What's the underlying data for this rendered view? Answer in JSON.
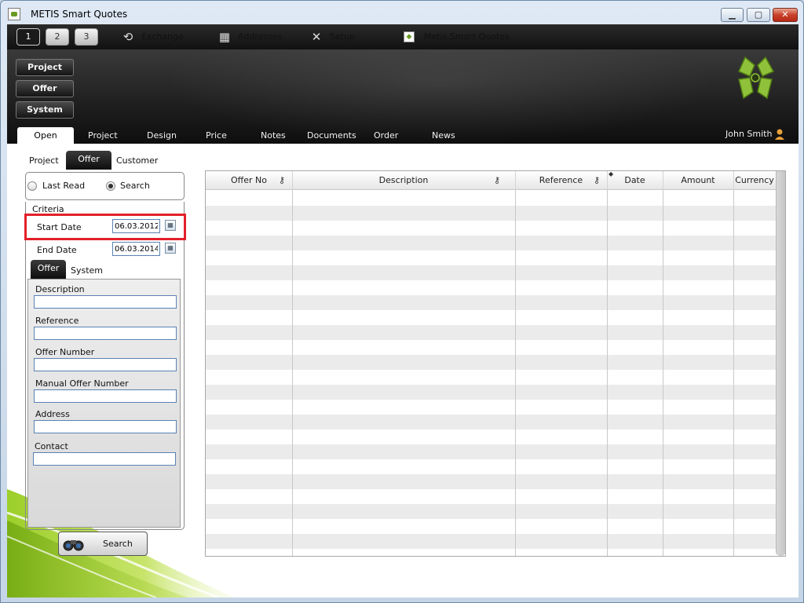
{
  "window": {
    "title": "METIS Smart Quotes",
    "minimize": "▁",
    "maximize": "▢",
    "close": "✕"
  },
  "toolbar": {
    "pages": [
      "1",
      "2",
      "3"
    ],
    "exchange": "Exchange",
    "addresses": "Addresses",
    "setup": "Setup",
    "metis": "Metis Smart Quotes"
  },
  "side_buttons": {
    "project": "Project",
    "offer": "Offer",
    "system": "System"
  },
  "tabs": [
    "Open",
    "Project",
    "Design",
    "Price",
    "Notes",
    "Documents",
    "Order",
    "News"
  ],
  "user": {
    "name": "John Smith"
  },
  "sub_tabs": {
    "project": "Project",
    "offer": "Offer",
    "customer": "Customer"
  },
  "radio": {
    "last_read": "Last Read",
    "search": "Search",
    "selected": "search"
  },
  "criteria": {
    "title": "Criteria",
    "start_date_label": "Start Date",
    "start_date": "06.03.2012",
    "end_date_label": "End Date",
    "end_date": "06.03.2014"
  },
  "criteria_tabs": {
    "offer": "Offer",
    "system": "System"
  },
  "fields": [
    {
      "label": "Description",
      "value": ""
    },
    {
      "label": "Reference",
      "value": ""
    },
    {
      "label": "Offer Number",
      "value": ""
    },
    {
      "label": "Manual Offer Number",
      "value": ""
    },
    {
      "label": "Address",
      "value": ""
    },
    {
      "label": "Contact",
      "value": ""
    }
  ],
  "search_button": "Search",
  "grid": {
    "columns": [
      "Offer No",
      "Description",
      "Reference",
      "Date",
      "Amount",
      "Currency"
    ]
  },
  "colors": {
    "highlight": "#e3202a",
    "accent_green": "#6a9a22",
    "dark_bar": "#111111"
  }
}
